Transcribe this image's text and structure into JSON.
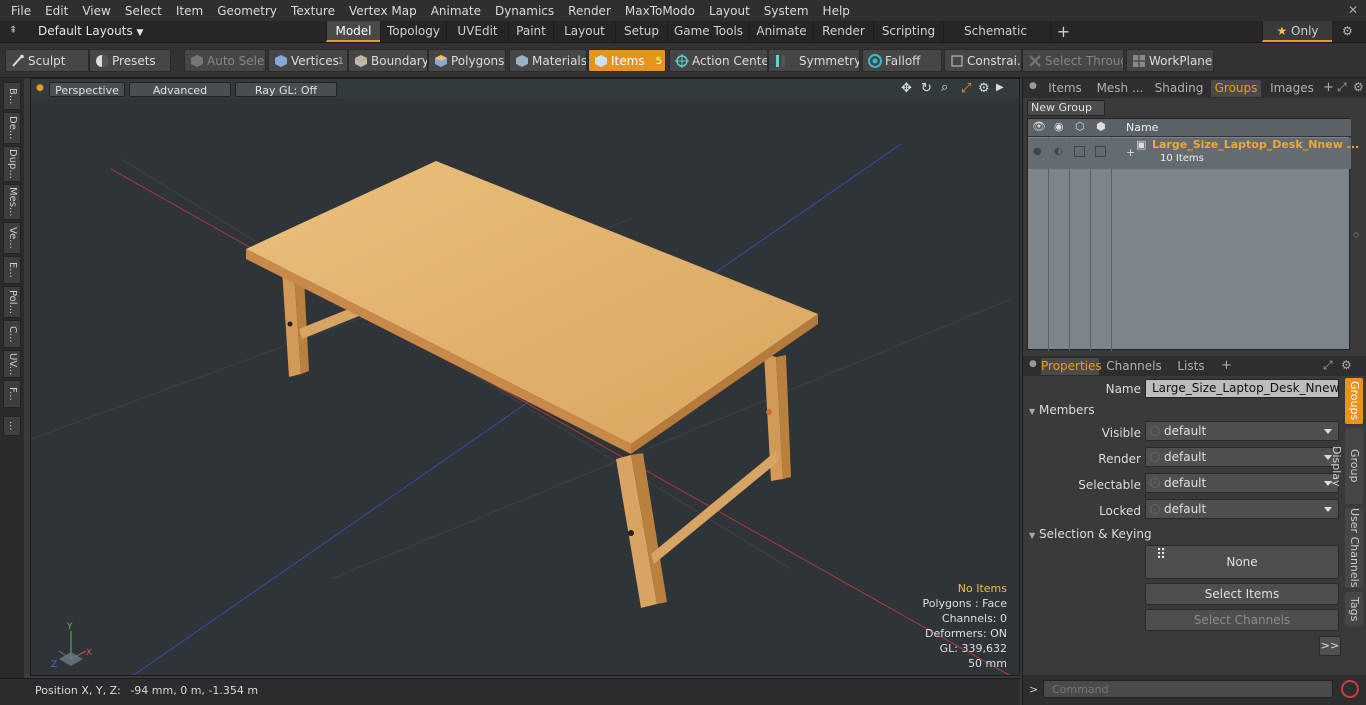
{
  "menu": [
    "File",
    "Edit",
    "View",
    "Select",
    "Item",
    "Geometry",
    "Texture",
    "Vertex Map",
    "Animate",
    "Dynamics",
    "Render",
    "MaxToModo",
    "Layout",
    "System",
    "Help"
  ],
  "layouts": {
    "label": "Default Layouts"
  },
  "mode_tabs": [
    "Model",
    "Topology",
    "UVEdit",
    "Paint",
    "Layout",
    "Setup",
    "Game Tools",
    "Animate",
    "Render",
    "Scripting",
    "Schematic Fusion"
  ],
  "only_label": "Only",
  "toolbar": {
    "sculpt": "Sculpt",
    "presets": "Presets",
    "auto_select": "Auto Select",
    "vertices": "Vertices",
    "vertices_count": "1",
    "boundary": "Boundary",
    "polygons": "Polygons",
    "materials": "Materials",
    "items": "Items",
    "items_count": "5",
    "action_center": "Action Center",
    "symmetry": "Symmetry",
    "falloff": "Falloff",
    "constraints": "Constrai...",
    "select_through": "Select Through",
    "workplane": "WorkPlane"
  },
  "left_tabs": [
    "B...",
    "De...",
    "Dup...",
    "Mes...",
    "Ve...",
    "E...",
    "Pol...",
    "C...",
    "UV...",
    "F...",
    "..."
  ],
  "viewport": {
    "perspective": "Perspective",
    "advanced": "Advanced",
    "raygl": "Ray GL: Off"
  },
  "stats": {
    "items": "No Items",
    "polygons": "Polygons : Face",
    "channels": "Channels: 0",
    "deformers": "Deformers: ON",
    "gl": "GL: 339,632",
    "scale": "50 mm"
  },
  "axis": {
    "x": "X",
    "y": "Y",
    "z": "Z"
  },
  "status": {
    "position_label": "Position X, Y, Z:",
    "position_value": "-94 mm, 0 m, -1.354 m"
  },
  "panel_tabs": [
    "Items",
    "Mesh ...",
    "Shading",
    "Groups",
    "Images"
  ],
  "new_group": "New Group",
  "group_header": {
    "name": "Name"
  },
  "group": {
    "name": "Large_Size_Laptop_Desk_Nnew ...",
    "count": "10 Items"
  },
  "prop_tabs": [
    "Properties",
    "Channels",
    "Lists"
  ],
  "props": {
    "name_label": "Name",
    "name_value": "Large_Size_Laptop_Desk_Nnewvante",
    "members": "Members",
    "visible_label": "Visible",
    "visible": "default",
    "render_label": "Render",
    "render": "default",
    "selectable_label": "Selectable",
    "selectable": "default",
    "locked_label": "Locked",
    "locked": "default",
    "selection_keying": "Selection & Keying",
    "none": "None",
    "select_items": "Select Items",
    "select_channels": "Select Channels",
    "more": ">>"
  },
  "side_tabs": [
    "Groups",
    "Group Display",
    "User Channels",
    "Tags"
  ],
  "command": {
    "placeholder": "Command",
    "prompt": ">"
  },
  "colors": {
    "accent": "#e99b27",
    "active_orange": "#e8931e"
  }
}
